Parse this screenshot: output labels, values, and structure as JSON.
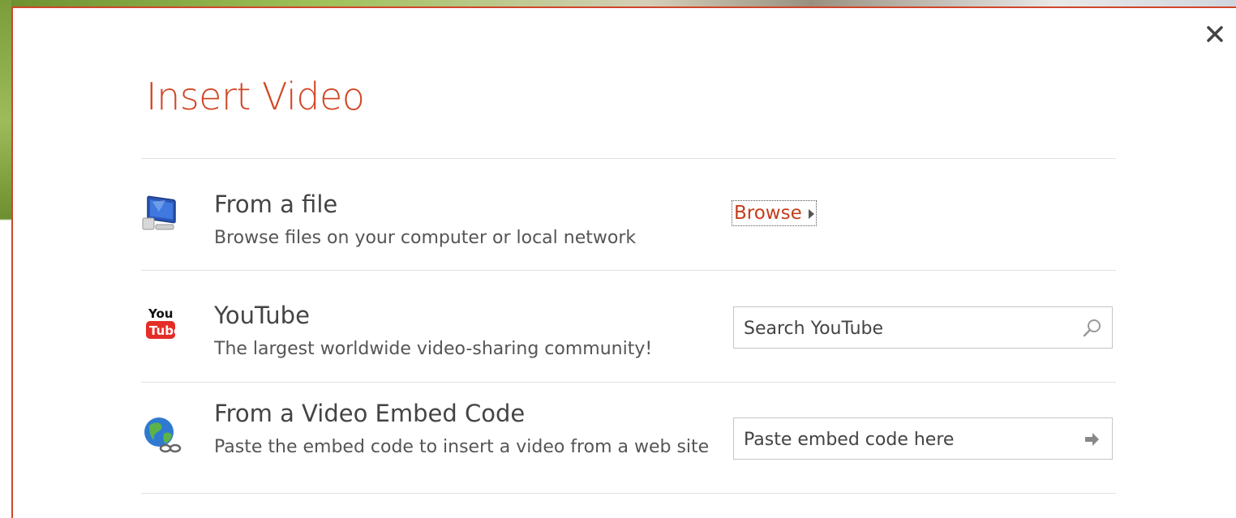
{
  "dialog": {
    "title": "Insert Video",
    "close_icon": "close-icon",
    "accent_color": "#d24726"
  },
  "options": [
    {
      "name": "From a file",
      "description": "Browse files on your computer or local network",
      "icon": "computer-icon",
      "action_label": "Browse"
    },
    {
      "name": "YouTube",
      "description": "The largest worldwide video-sharing community!",
      "icon": "youtube-icon",
      "input_placeholder": "Search YouTube",
      "action_icon": "search-icon"
    },
    {
      "name": "From a Video Embed Code",
      "description": "Paste the embed code to insert a video from a web site",
      "icon": "globe-icon",
      "input_placeholder": "Paste embed code here",
      "action_icon": "arrow-right-icon"
    }
  ]
}
